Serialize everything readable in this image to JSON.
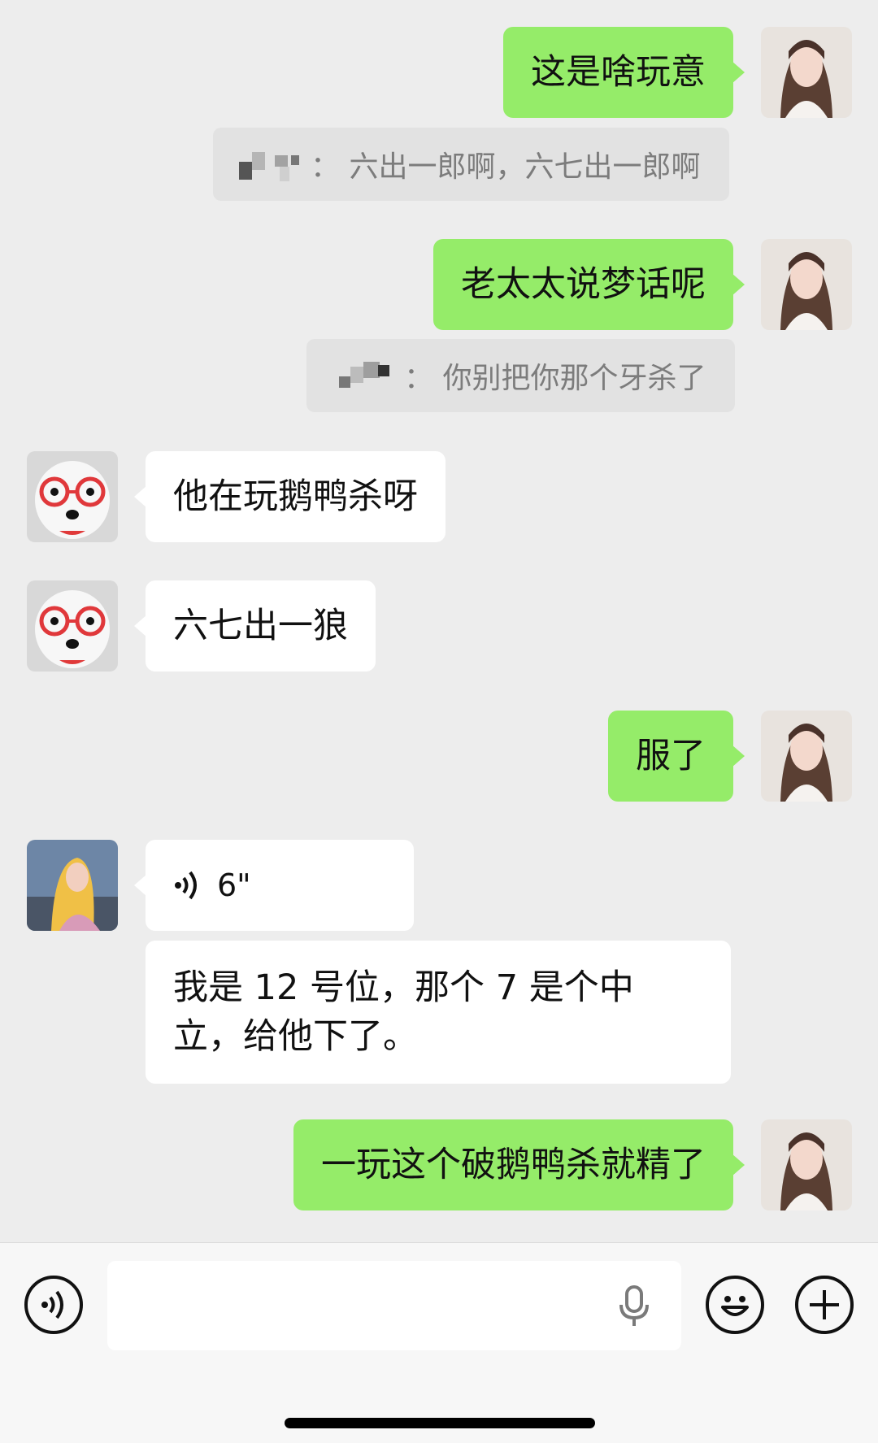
{
  "messages": [
    {
      "text": "这是啥玩意"
    },
    {
      "quote_text": "：  六出一郎啊，六七出一郎啊"
    },
    {
      "text": "老太太说梦话呢"
    },
    {
      "quote_text": "：  你别把你那个牙杀了"
    },
    {
      "text": "他在玩鹅鸭杀呀"
    },
    {
      "text": "六七出一狼"
    },
    {
      "text": "服了"
    },
    {
      "voice_duration": "6\""
    },
    {
      "text": "我是 12 号位，那个 7 是个中立，给他下了。"
    },
    {
      "text": "一玩这个破鹅鸭杀就精了"
    }
  ],
  "colors": {
    "sent_bubble": "#95ec69",
    "received_bubble": "#ffffff",
    "background": "#ededed"
  },
  "toolbar": {
    "voice_toggle_icon": "voice-wave-icon",
    "mic_icon": "microphone-icon",
    "emoji_icon": "emoji-icon",
    "more_icon": "plus-icon"
  }
}
